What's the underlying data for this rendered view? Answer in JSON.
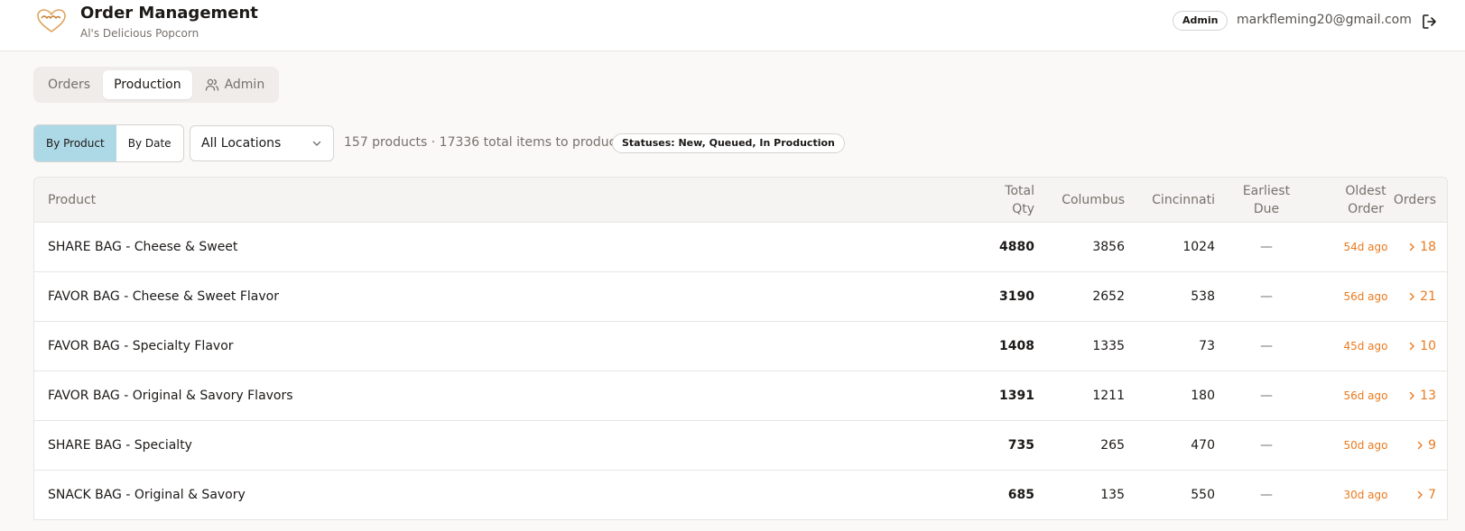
{
  "header": {
    "title": "Order Management",
    "subtitle": "Al's Delicious Popcorn",
    "role": "Admin",
    "email": "markfleming20@gmail.com"
  },
  "tabs": [
    {
      "label": "Orders",
      "active": false
    },
    {
      "label": "Production",
      "active": true
    },
    {
      "label": "Admin",
      "active": false
    }
  ],
  "toolbar": {
    "view_by_product": "By Product",
    "view_by_date": "By Date",
    "location": "All Locations",
    "summary": "157 products · 17336 total items to produce",
    "statuses": "Statuses: New, Queued, In Production"
  },
  "table": {
    "headers": {
      "product": "Product",
      "total_qty_1": "Total",
      "total_qty_2": "Qty",
      "columbus": "Columbus",
      "cincinnati": "Cincinnati",
      "earliest_due_1": "Earliest",
      "earliest_due_2": "Due",
      "oldest_order_1": "Oldest",
      "oldest_order_2": "Order",
      "orders": "Orders"
    },
    "rows": [
      {
        "product": "SHARE BAG - Cheese & Sweet",
        "total": "4880",
        "columbus": "3856",
        "cincinnati": "1024",
        "due": "—",
        "oldest": "54d ago",
        "orders": "18"
      },
      {
        "product": "FAVOR BAG - Cheese & Sweet Flavor",
        "total": "3190",
        "columbus": "2652",
        "cincinnati": "538",
        "due": "—",
        "oldest": "56d ago",
        "orders": "21"
      },
      {
        "product": "FAVOR BAG - Specialty Flavor",
        "total": "1408",
        "columbus": "1335",
        "cincinnati": "73",
        "due": "—",
        "oldest": "45d ago",
        "orders": "10"
      },
      {
        "product": "FAVOR BAG - Original & Savory Flavors",
        "total": "1391",
        "columbus": "1211",
        "cincinnati": "180",
        "due": "—",
        "oldest": "56d ago",
        "orders": "13"
      },
      {
        "product": "SHARE BAG - Specialty",
        "total": "735",
        "columbus": "265",
        "cincinnati": "470",
        "due": "—",
        "oldest": "50d ago",
        "orders": "9"
      },
      {
        "product": "SNACK BAG - Original & Savory",
        "total": "685",
        "columbus": "135",
        "cincinnati": "550",
        "due": "—",
        "oldest": "30d ago",
        "orders": "7"
      }
    ]
  },
  "colors": {
    "accent_orange": "#ea7a1e",
    "active_toggle": "#add8e6"
  },
  "icons": {
    "logo": "popcorn-heart-logo",
    "logout": "logout-icon",
    "admin_tab": "users-icon",
    "location": "chevron-down-icon",
    "orders": "chevron-right-icon"
  }
}
